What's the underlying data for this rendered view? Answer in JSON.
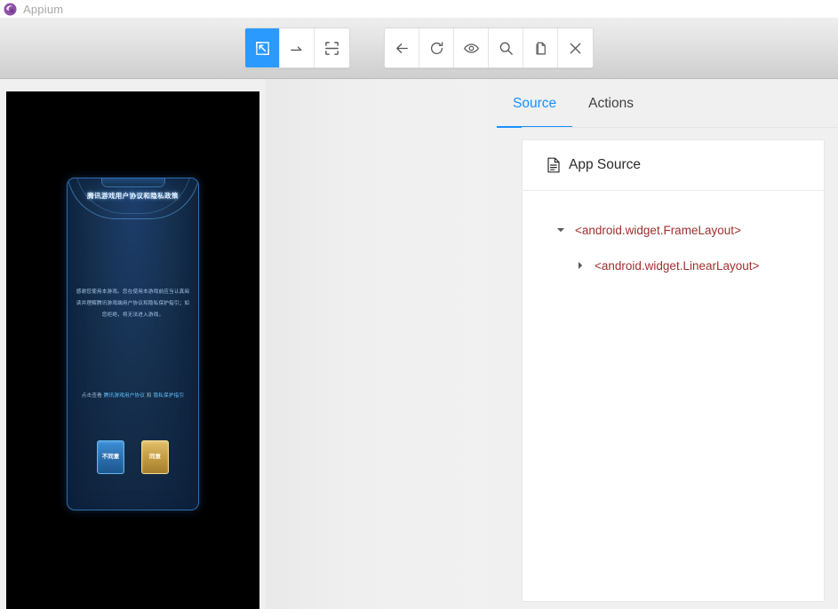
{
  "window": {
    "title": "Appium",
    "logo_icon": "appium-logo-icon"
  },
  "toolbar": {
    "group_select": [
      {
        "name": "select-element-mode-button",
        "icon": "cursor-select-icon",
        "active": true,
        "label": "Select Elements"
      },
      {
        "name": "swipe-mode-button",
        "icon": "swipe-arrow-icon",
        "active": false,
        "label": "Swipe By Coordinates"
      },
      {
        "name": "tap-mode-button",
        "icon": "tap-crosshair-icon",
        "active": false,
        "label": "Tap By Coordinates"
      }
    ],
    "group_actions": [
      {
        "name": "back-button",
        "icon": "arrow-left-icon",
        "label": "Back"
      },
      {
        "name": "refresh-source-button",
        "icon": "refresh-icon",
        "label": "Refresh Source"
      },
      {
        "name": "toggle-highlight-button",
        "icon": "eye-icon",
        "label": "Toggle Element Highlight"
      },
      {
        "name": "search-element-button",
        "icon": "search-icon",
        "label": "Search for Element"
      },
      {
        "name": "copy-source-button",
        "icon": "copy-icon",
        "label": "Copy XML Source"
      },
      {
        "name": "quit-session-button",
        "icon": "close-x-icon",
        "label": "Quit Session"
      }
    ]
  },
  "screenshot": {
    "device_background": "#000000",
    "dialog": {
      "title": "腾讯游戏用户协议和隐私政策",
      "body": "感谢您使用本游戏。您在使用本游戏前应当认真阅读并理解腾讯游戏端用户协议和隐私保护指引；如您拒绝，将无法进入游戏。",
      "link_prefix": "点击查看",
      "link_text": "腾讯游戏用户协议",
      "link_separator": "和",
      "link_text2": "隐私保护指引",
      "buttons": [
        {
          "name": "dialog-cancel-button",
          "label": "不同意",
          "color": "#2a6ead"
        },
        {
          "name": "dialog-confirm-button",
          "label": "同意",
          "color": "#c39b43"
        }
      ]
    }
  },
  "inspector": {
    "tabs": [
      {
        "name": "tab-source",
        "label": "Source",
        "active": true
      },
      {
        "name": "tab-actions",
        "label": "Actions",
        "active": false
      }
    ],
    "card": {
      "icon": "document-icon",
      "title": "App Source"
    },
    "tree": [
      {
        "depth": 0,
        "caret": "expanded",
        "label": "<android.widget.FrameLayout>"
      },
      {
        "depth": 1,
        "caret": "collapsed",
        "label": "<android.widget.LinearLayout>"
      }
    ]
  },
  "colors": {
    "accent": "#1890ff",
    "active_tool": "#2a9afe",
    "tree_text": "#a03030"
  }
}
